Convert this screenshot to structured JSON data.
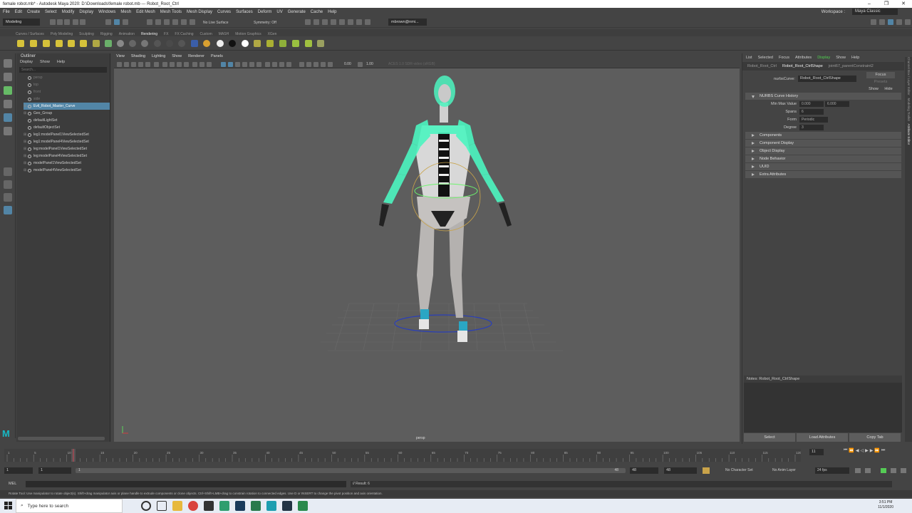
{
  "window": {
    "title": "female robot.mb* - Autodesk Maya 2020: D:\\Downloads\\female robot.mb   ---   Robot_Root_Ctrl",
    "controls": [
      "–",
      "❐",
      "✕"
    ]
  },
  "menubar": {
    "items": [
      "File",
      "Edit",
      "Create",
      "Select",
      "Modify",
      "Display",
      "Windows",
      "Mesh",
      "Edit Mesh",
      "Mesh Tools",
      "Mesh Display",
      "Curves",
      "Surfaces",
      "Deform",
      "UV",
      "Generate",
      "Cache",
      "Help"
    ],
    "workspace_label": "Workspace :",
    "workspace_value": "Maya Classic"
  },
  "statusline": {
    "mode": "Modeling",
    "live_surface": "No Live Surface",
    "symmetry": "Symmetry: Off",
    "user": "mbrown@nmi..."
  },
  "shelf": {
    "tabs": [
      "Curves / Surfaces",
      "Poly Modeling",
      "Sculpting",
      "Rigging",
      "Animation",
      "Rendering",
      "FX",
      "FX Caching",
      "Custom",
      "MASH",
      "Motion Graphics",
      "XGen"
    ],
    "active_tab": "Rendering"
  },
  "outliner": {
    "title": "Outliner",
    "menu": [
      "Display",
      "Show",
      "Help"
    ],
    "search_placeholder": "Search...",
    "items": [
      {
        "label": "persp",
        "expand": "",
        "state": "dim"
      },
      {
        "label": "top",
        "expand": "",
        "state": "dim"
      },
      {
        "label": "front",
        "expand": "",
        "state": "dim"
      },
      {
        "label": "side",
        "expand": "",
        "state": "dim"
      },
      {
        "label": "Evil_Robot_Master_Curve",
        "expand": "⊞",
        "state": "selected"
      },
      {
        "label": "Geo_Group",
        "expand": "⊞",
        "state": ""
      },
      {
        "label": "defaultLightSet",
        "expand": "",
        "state": ""
      },
      {
        "label": "defaultObjectSet",
        "expand": "",
        "state": ""
      },
      {
        "label": "leg1:modelPanel1ViewSelectedSet",
        "expand": "⊞",
        "state": ""
      },
      {
        "label": "leg1:modelPanel4ViewSelectedSet",
        "expand": "⊞",
        "state": ""
      },
      {
        "label": "leg:modelPanel1ViewSelectedSet",
        "expand": "⊞",
        "state": ""
      },
      {
        "label": "leg:modelPanel4ViewSelectedSet",
        "expand": "⊞",
        "state": ""
      },
      {
        "label": "modelPanel1ViewSelectedSet",
        "expand": "⊞",
        "state": ""
      },
      {
        "label": "modelPanel4ViewSelectedSet",
        "expand": "⊞",
        "state": ""
      }
    ]
  },
  "viewport": {
    "menu": [
      "View",
      "Shading",
      "Lighting",
      "Show",
      "Renderer",
      "Panels"
    ],
    "field1": "0.00",
    "field2": "1.00",
    "colorspace": "ACES 1.0 SDR-video (sRGB)",
    "camera": "persp"
  },
  "attribute_editor": {
    "header": [
      "List",
      "Selected",
      "Focus",
      "Attributes",
      "Display",
      "Show",
      "Help"
    ],
    "header_highlight": "Display",
    "tabs": [
      "Robot_Root_Ctrl",
      "Robot_Root_CtrlShape",
      "joint67_parentConstraint2"
    ],
    "active_tab": "Robot_Root_CtrlShape",
    "node_label": "nurbsCurve:",
    "node_value": "Robot_Root_CtrlShape",
    "focus_button": "Focus",
    "presets_button": "Presets",
    "show_button": "Show",
    "hide_button": "Hide",
    "section_title": "NURBS Curve History",
    "attributes": [
      {
        "label": "Min Max Value",
        "v1": "0.000",
        "v2": "6.000"
      },
      {
        "label": "Spans",
        "v1": "6",
        "v2": ""
      },
      {
        "label": "Form",
        "v1": "Periodic",
        "v2": ""
      },
      {
        "label": "Degree",
        "v1": "3",
        "v2": ""
      }
    ],
    "sections": [
      "Components",
      "Component Display",
      "Object Display",
      "Node Behavior",
      "UUID",
      "Extra Attributes"
    ],
    "notes_label": "Notes: Robot_Root_CtrlShape",
    "buttons": [
      "Select",
      "Load Attributes",
      "Copy Tab"
    ],
    "side_tabs": [
      "Channel Box / Layer Editor",
      "Modeling Toolkit",
      "Attribute Editor"
    ]
  },
  "timeline": {
    "ticks": [
      "1",
      "5",
      "10",
      "15",
      "20",
      "25",
      "30",
      "35",
      "40",
      "45",
      "50",
      "55",
      "60",
      "65",
      "70",
      "75",
      "80",
      "85",
      "90",
      "95",
      "100",
      "105",
      "110",
      "115",
      "120"
    ],
    "current_frame": "11",
    "current_frame_field": "11",
    "range_start": "1",
    "range_inner_start": "1",
    "range_inner_end": "48",
    "range_end_field": "48",
    "range_end": "48",
    "character_set": "No Character Set",
    "anim_layer": "No Anim Layer",
    "fps": "24 fps"
  },
  "cmdline": {
    "lang": "MEL",
    "result": "// Result: 6"
  },
  "helpline": "Rotate Tool: Use manipulator to rotate object(s). Shift+drag manipulator axis or plane handle to extrude components or clone objects. Ctrl+Shift+LMB+drag to constrain rotation to connected edges. Use D or INSERT to change the pivot position and axis orientation.",
  "taskbar": {
    "search_placeholder": "Type here to search",
    "time": "3:51 PM",
    "date": "11/1/2020"
  },
  "colors": {
    "accent": "#5285a6",
    "rig_green": "#4cf5c0",
    "viewport_bg": "#5d5d5d",
    "current_frame": "#d04050"
  }
}
